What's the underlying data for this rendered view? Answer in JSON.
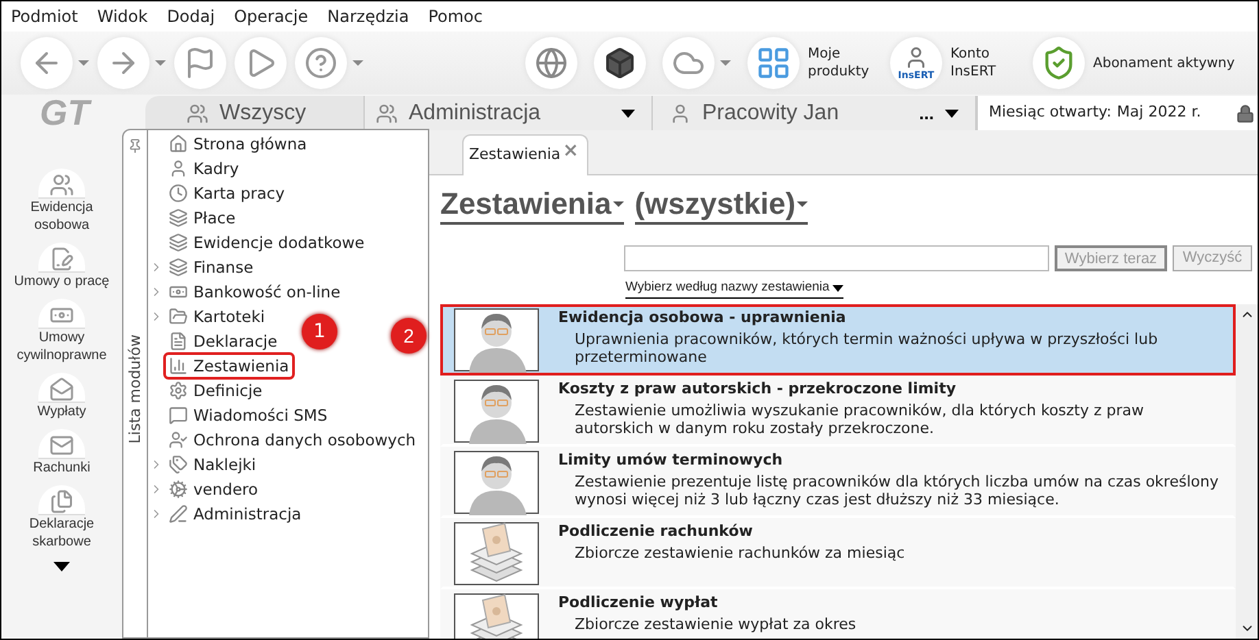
{
  "menu": [
    "Podmiot",
    "Widok",
    "Dodaj",
    "Operacje",
    "Narzędzia",
    "Pomoc"
  ],
  "toolbar": {
    "tools": [
      {
        "kind": "back",
        "dropdown": true
      },
      {
        "kind": "forward",
        "dropdown": true
      },
      {
        "kind": "flag",
        "dropdown": false
      },
      {
        "kind": "play",
        "dropdown": false
      },
      {
        "kind": "help",
        "dropdown": true
      }
    ],
    "right_tools": [
      {
        "kind": "globe",
        "dropdown": false
      },
      {
        "kind": "cube",
        "dropdown": false
      },
      {
        "kind": "cloud",
        "dropdown": true
      }
    ],
    "links": [
      {
        "kind": "products",
        "label": "Moje produkty"
      },
      {
        "kind": "account",
        "label": "Konto InsERT",
        "badge": "InsERT"
      },
      {
        "kind": "shield",
        "label": "Abonament aktywny"
      }
    ]
  },
  "logo": "GT",
  "context": {
    "group_tab": "Wszyscy",
    "department": "Administracja",
    "employee": "Pracowity Jan",
    "more": "...",
    "month_label": "Miesiąc otwarty:",
    "month_value": "Maj 2022 r."
  },
  "rail": {
    "items": [
      {
        "kind": "people",
        "label": "Ewidencja osobowa"
      },
      {
        "kind": "contract",
        "label": "Umowy o pracę"
      },
      {
        "kind": "money",
        "label": "Umowy cywilnoprawne"
      },
      {
        "kind": "envelope",
        "label": "Wypłaty"
      },
      {
        "kind": "mail",
        "label": "Rachunki"
      },
      {
        "kind": "docs",
        "label": "Deklaracje skarbowe"
      }
    ]
  },
  "modules": {
    "title": "Lista modułów",
    "items": [
      {
        "label": "Strona główna",
        "expandable": false,
        "highlighted": false
      },
      {
        "label": "Kadry",
        "expandable": false,
        "highlighted": false
      },
      {
        "label": "Karta pracy",
        "expandable": false,
        "highlighted": false
      },
      {
        "label": "Płace",
        "expandable": false,
        "highlighted": false
      },
      {
        "label": "Ewidencje dodatkowe",
        "expandable": false,
        "highlighted": false
      },
      {
        "label": "Finanse",
        "expandable": true,
        "highlighted": false
      },
      {
        "label": "Bankowość on-line",
        "expandable": true,
        "highlighted": false
      },
      {
        "label": "Kartoteki",
        "expandable": true,
        "highlighted": false
      },
      {
        "label": "Deklaracje",
        "expandable": false,
        "highlighted": false
      },
      {
        "label": "Zestawienia",
        "expandable": false,
        "highlighted": true
      },
      {
        "label": "Definicje",
        "expandable": false,
        "highlighted": false
      },
      {
        "label": "Wiadomości SMS",
        "expandable": false,
        "highlighted": false
      },
      {
        "label": "Ochrona danych osobowych",
        "expandable": false,
        "highlighted": false
      },
      {
        "label": "Naklejki",
        "expandable": true,
        "highlighted": false
      },
      {
        "label": "vendero",
        "expandable": true,
        "highlighted": false
      },
      {
        "label": "Administracja",
        "expandable": true,
        "highlighted": false
      }
    ]
  },
  "callouts": [
    "1",
    "2"
  ],
  "doc_tab": {
    "label": "Zestawienia",
    "close": "×"
  },
  "header": {
    "category": "Zestawienia",
    "filter": "(wszystkie)"
  },
  "search": {
    "choose_button": "Wybierz teraz",
    "clear_button": "Wyczyść",
    "by_name_link": "Wybierz według nazwy zestawienia"
  },
  "reports": [
    {
      "kind": "person",
      "title": "Ewidencja osobowa - uprawnienia",
      "description": "Uprawnienia pracowników, których termin ważności upływa w przyszłości lub przeterminowane",
      "selected": true
    },
    {
      "kind": "person",
      "title": "Koszty z praw autorskich - przekroczone limity",
      "description": "Zestawienie umożliwia wyszukanie pracowników, dla których koszty z praw autorskich w danym roku zostały przekroczone.",
      "selected": false
    },
    {
      "kind": "person",
      "title": "Limity umów terminowych",
      "description": "Zestawienie prezentuje listę pracowników dla których liczba umów na czas określony wynosi więcej niż 3 lub łączny czas jest dłuższy niż 33 miesiące.",
      "selected": false
    },
    {
      "kind": "money",
      "title": "Podliczenie rachunków",
      "description": "Zbiorcze zestawienie rachunków za miesiąc",
      "selected": false
    },
    {
      "kind": "money",
      "title": "Podliczenie wypłat",
      "description": "Zbiorcze zestawienie wypłat za okres",
      "selected": false
    }
  ]
}
